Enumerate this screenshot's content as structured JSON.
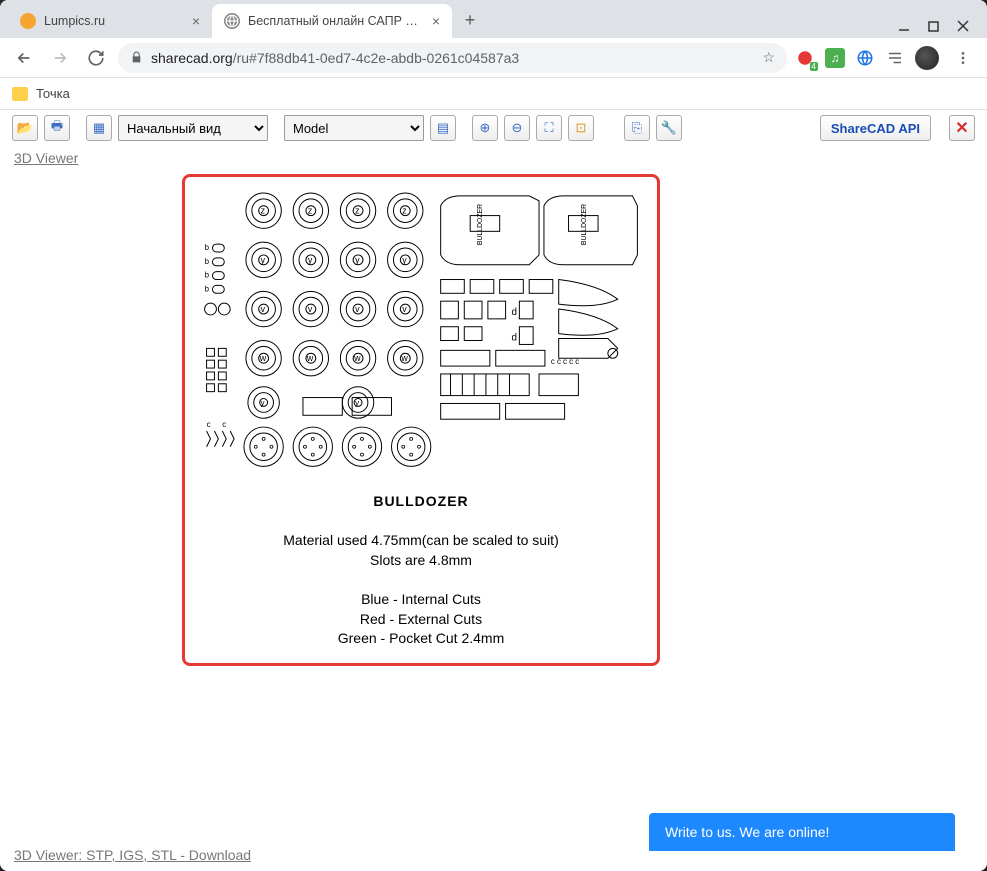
{
  "browser": {
    "tabs": [
      {
        "title": "Lumpics.ru",
        "active": false
      },
      {
        "title": "Бесплатный онлайн САПР прос",
        "active": true
      }
    ],
    "url_prefix": "sharecad.org",
    "url_suffix": "/ru#7f88db41-0ed7-4c2e-abdb-0261c04587a3",
    "ext_badge": "4",
    "bookmark": "Точка"
  },
  "toolbar": {
    "view_select": "Начальный вид",
    "model_select": "Model",
    "api_btn": "ShareCAD API"
  },
  "links": {
    "viewer3d": "3D Viewer",
    "bottom": "3D Viewer: STP, IGS, STL - Download"
  },
  "cad": {
    "title": "BULLDOZER",
    "line1": "Material used 4.75mm(can be scaled to suit)",
    "line2": "Slots are 4.8mm",
    "line3": "Blue - Internal Cuts",
    "line4": "Red - External Cuts",
    "line5": "Green - Pocket Cut 2.4mm"
  },
  "chat": {
    "text": "Write to us. We are online!"
  }
}
